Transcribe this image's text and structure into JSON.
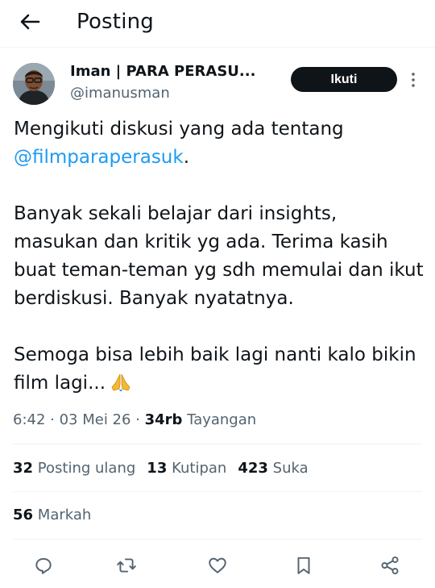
{
  "header": {
    "title": "Posting"
  },
  "author": {
    "name": "Iman | PARA PERASU...",
    "handle": "@imanusman"
  },
  "follow_label": "Ikuti",
  "post": {
    "line1_prefix": "Mengikuti diskusi yang ada tentang",
    "mention": "@filmparaperasuk",
    "mention_suffix": ".",
    "paragraph2": "Banyak sekali belajar dari insights, masukan dan kritik yg ada. Terima kasih buat teman-teman yg sdh memulai dan ikut berdiskusi. Banyak nyatatnya.",
    "paragraph3": "Semoga bisa lebih baik lagi nanti kalo bikin film lagi...",
    "emoji_icon": "folded-hands-emoji"
  },
  "meta": {
    "time": "6:42",
    "date": "03 Mei 26",
    "views_count": "34rb",
    "views_label": "Tayangan"
  },
  "stats": {
    "reposts": {
      "count": "32",
      "label": "Posting ulang"
    },
    "quotes": {
      "count": "13",
      "label": "Kutipan"
    },
    "likes": {
      "count": "423",
      "label": "Suka"
    },
    "bookmarks": {
      "count": "56",
      "label": "Markah"
    }
  },
  "actions": [
    "reply-icon",
    "repost-icon",
    "like-icon",
    "bookmark-icon",
    "share-icon"
  ],
  "colors": {
    "text": "#0f1419",
    "secondary": "#536471",
    "link": "#1d9bf0",
    "follow_bg": "#0f1419",
    "divider": "#eff3f4"
  }
}
